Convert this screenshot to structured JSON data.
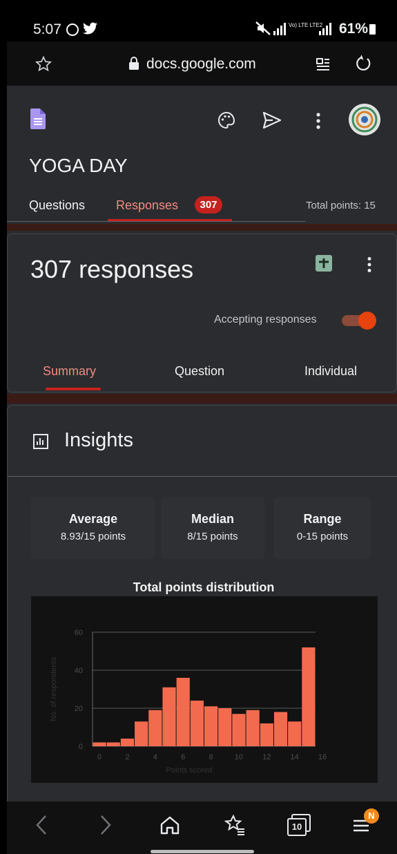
{
  "status": {
    "time": "5:07",
    "network": "Vo) LTE LTE2",
    "battery": "61%"
  },
  "browser": {
    "url": "docs.google.com"
  },
  "form": {
    "title": "YOGA DAY",
    "tab_questions": "Questions",
    "tab_responses": "Responses",
    "responses_badge": "307",
    "total_points": "Total points: 15"
  },
  "responses_card": {
    "title": "307 responses",
    "accepting_label": "Accepting responses",
    "accepting_on": true,
    "tab_summary": "Summary",
    "tab_question": "Question",
    "tab_individual": "Individual"
  },
  "insights": {
    "title": "Insights",
    "average_label": "Average",
    "average_value": "8.93/15 points",
    "median_label": "Median",
    "median_value": "8/15 points",
    "range_label": "Range",
    "range_value": "0-15 points",
    "chart_title": "Total points distribution"
  },
  "chart_data": {
    "type": "bar",
    "title": "Total points distribution",
    "xlabel": "Points scored",
    "ylabel": "No. of respondents",
    "categories": [
      0,
      1,
      2,
      3,
      4,
      5,
      6,
      7,
      8,
      9,
      10,
      11,
      12,
      13,
      14,
      15
    ],
    "values": [
      2,
      2,
      4,
      13,
      19,
      31,
      36,
      24,
      21,
      20,
      17,
      19,
      12,
      18,
      13,
      52
    ],
    "xticks": [
      0,
      2,
      4,
      6,
      8,
      10,
      12,
      14,
      16
    ],
    "yticks": [
      0,
      20,
      40,
      60
    ],
    "ylim": [
      0,
      60
    ],
    "xlim": [
      0,
      16
    ],
    "bar_color": "#f26b4f",
    "grid": true
  },
  "bottom_nav": {
    "tabs_count": "10",
    "notification_badge": "N"
  },
  "colors": {
    "accent": "#f28b82",
    "badge": "#c5221f",
    "toggle": "#e8430e",
    "bar": "#f26b4f",
    "sheets": "#8ab4a0"
  }
}
